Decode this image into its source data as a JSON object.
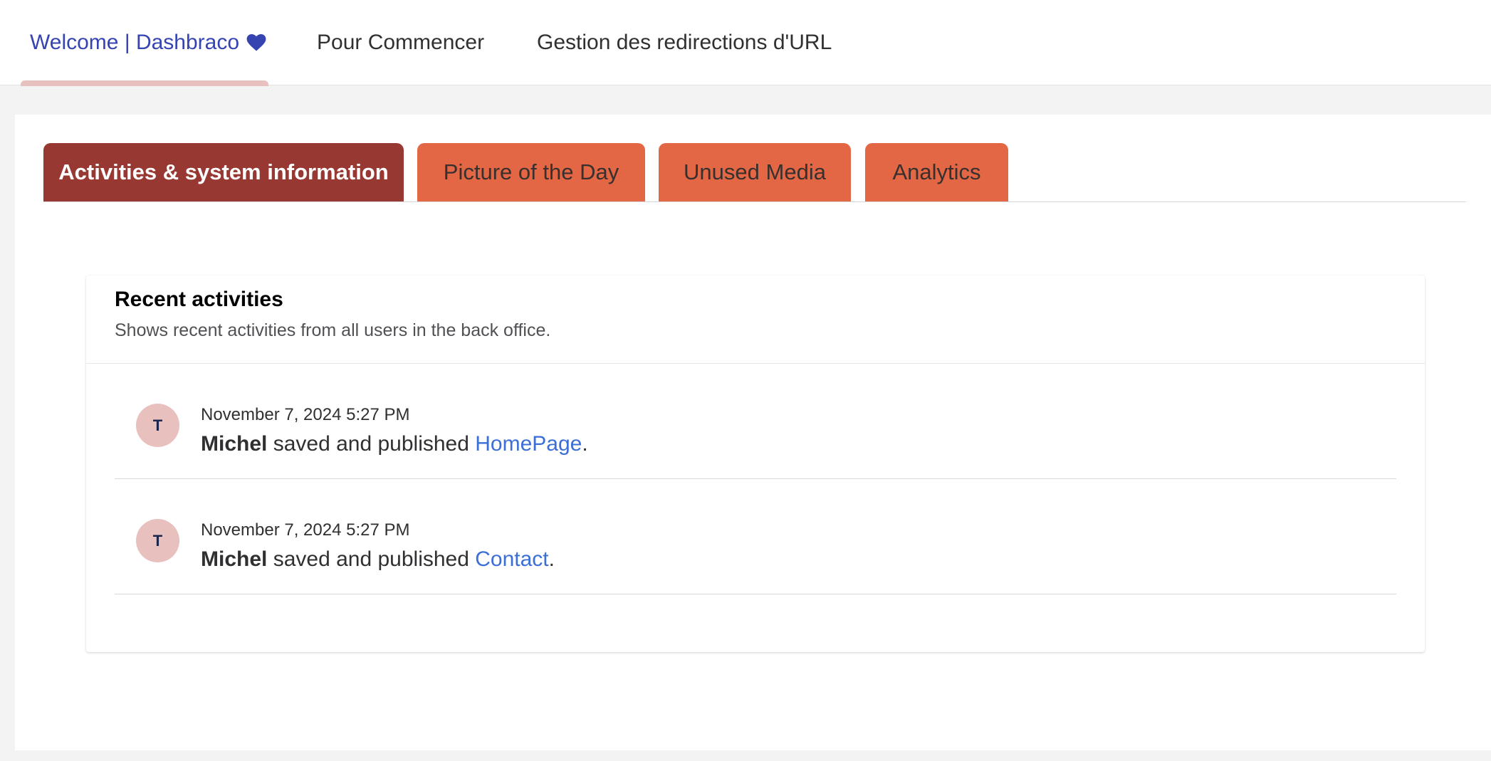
{
  "top_tabs": [
    {
      "label": "Welcome | Dashbraco",
      "icon": "heart-icon",
      "active": true
    },
    {
      "label": "Pour Commencer",
      "active": false
    },
    {
      "label": "Gestion des redirections d'URL",
      "active": false
    }
  ],
  "dashboard_tabs": [
    {
      "label": "Activities & system information",
      "active": true
    },
    {
      "label": "Picture of the Day",
      "active": false
    },
    {
      "label": "Unused Media",
      "active": false
    },
    {
      "label": "Analytics",
      "active": false
    }
  ],
  "recent_activities": {
    "title": "Recent activities",
    "subtitle": "Shows recent activities from all users in the back office.",
    "items": [
      {
        "avatar_initial": "T",
        "timestamp": "November 7, 2024 5:27 PM",
        "user": "Michel",
        "action": " saved and published ",
        "target": "HomePage",
        "end": "."
      },
      {
        "avatar_initial": "T",
        "timestamp": "November 7, 2024 5:27 PM",
        "user": "Michel",
        "action": " saved and published ",
        "target": "Contact",
        "end": "."
      }
    ]
  },
  "colors": {
    "active_tab_bg": "#973832",
    "inactive_tab_bg": "#e36744",
    "top_tab_active_text": "#3544b1",
    "link": "#3b6fd6",
    "avatar_bg": "#e8c0bd"
  }
}
